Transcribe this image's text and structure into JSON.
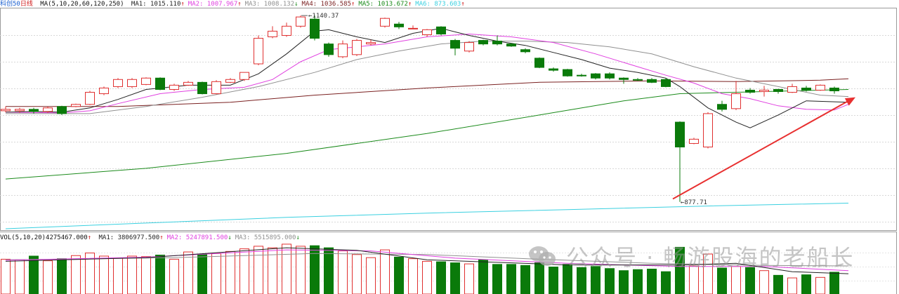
{
  "chart_data": {
    "type": "candlestick",
    "title": "科创50日线",
    "instrument": "科创50",
    "period": "日线",
    "ma_label": "MA(5,10,20,60,120,250)",
    "ma_readouts": [
      {
        "name": "MA1",
        "value": "1015.110",
        "arrow": "↑",
        "color": "#222222"
      },
      {
        "name": "MA2",
        "value": "1007.967",
        "arrow": "↑",
        "color": "#e040e0"
      },
      {
        "name": "MA3",
        "value": "1008.132",
        "arrow": "↓",
        "color": "#909090"
      },
      {
        "name": "MA4",
        "value": "1036.585",
        "arrow": "↑",
        "color": "#7a2020"
      },
      {
        "name": "MA5",
        "value": "1013.672",
        "arrow": "↑",
        "color": "#1a8a1a"
      },
      {
        "name": "MA6",
        "value": "873.603",
        "arrow": "↑",
        "color": "#3ad0e0"
      }
    ],
    "annotations": {
      "high_label": "1140.37",
      "low_label": "877.71"
    },
    "price_range": [
      840,
      1150
    ],
    "candles": [
      [
        1006,
        1008,
        1012,
        1004
      ],
      [
        1006,
        1008,
        1010,
        1003
      ],
      [
        1008,
        1005,
        1010,
        1002
      ],
      [
        1005,
        1010,
        1012,
        1003
      ],
      [
        1012,
        1002,
        1013,
        1000
      ],
      [
        1012,
        1015,
        1016,
        1011
      ],
      [
        1015,
        1032,
        1034,
        1014
      ],
      [
        1030,
        1038,
        1040,
        1028
      ],
      [
        1040,
        1050,
        1052,
        1038
      ],
      [
        1040,
        1050,
        1052,
        1038
      ],
      [
        1043,
        1052,
        1053,
        1042
      ],
      [
        1052,
        1036,
        1053,
        1035
      ],
      [
        1036,
        1042,
        1044,
        1034
      ],
      [
        1042,
        1046,
        1048,
        1041
      ],
      [
        1046,
        1030,
        1047,
        1029
      ],
      [
        1030,
        1047,
        1049,
        1029
      ],
      [
        1046,
        1050,
        1052,
        1045
      ],
      [
        1050,
        1060,
        1060,
        1048
      ],
      [
        1072,
        1108,
        1112,
        1070
      ],
      [
        1110,
        1118,
        1125,
        1108
      ],
      [
        1112,
        1125,
        1130,
        1110
      ],
      [
        1125,
        1138,
        1140,
        1123
      ],
      [
        1135,
        1108,
        1140,
        1105
      ],
      [
        1100,
        1085,
        1102,
        1082
      ],
      [
        1082,
        1100,
        1105,
        1080
      ],
      [
        1085,
        1105,
        1107,
        1083
      ],
      [
        1100,
        1102,
        1106,
        1098
      ],
      [
        1125,
        1136,
        1137,
        1123
      ],
      [
        1128,
        1124,
        1131,
        1121
      ],
      [
        1122,
        1122,
        1126,
        1121
      ],
      [
        1113,
        1120,
        1121,
        1110
      ],
      [
        1124,
        1114,
        1125,
        1112
      ],
      [
        1105,
        1094,
        1107,
        1084
      ],
      [
        1090,
        1102,
        1104,
        1088
      ],
      [
        1105,
        1100,
        1106,
        1098
      ],
      [
        1104,
        1100,
        1112,
        1098
      ],
      [
        1100,
        1097,
        1101,
        1096
      ],
      [
        1092,
        1089,
        1094,
        1087
      ],
      [
        1080,
        1067,
        1081,
        1066
      ],
      [
        1065,
        1063,
        1067,
        1061
      ],
      [
        1064,
        1055,
        1065,
        1054
      ],
      [
        1056,
        1055,
        1058,
        1054
      ],
      [
        1058,
        1052,
        1059,
        1050
      ],
      [
        1058,
        1052,
        1060,
        1050
      ],
      [
        1052,
        1050,
        1053,
        1044
      ],
      [
        1050,
        1049,
        1052,
        1048
      ],
      [
        1050,
        1046,
        1052,
        1045
      ],
      [
        1050,
        1040,
        1052,
        1039
      ],
      [
        990,
        955,
        991,
        877.71
      ],
      [
        960,
        966,
        968,
        959
      ],
      [
        955,
        1002,
        1004,
        953
      ],
      [
        1015,
        1008,
        1020,
        1005
      ],
      [
        1009,
        1030,
        1048,
        1007
      ],
      [
        1035,
        1032,
        1038,
        1030
      ],
      [
        1033,
        1035,
        1041,
        1026
      ],
      [
        1036,
        1033,
        1037,
        1030
      ],
      [
        1032,
        1040,
        1044,
        1031
      ],
      [
        1038,
        1035,
        1041,
        1033
      ],
      [
        1035,
        1042,
        1043,
        1034
      ],
      [
        1038,
        1034,
        1040,
        1030
      ]
    ],
    "ma_series": [
      {
        "name": "MA1",
        "period": 5,
        "color": "#222222",
        "points": [
          [
            0,
            1004
          ],
          [
            2,
            1005
          ],
          [
            4,
            1004
          ],
          [
            6,
            1010
          ],
          [
            8,
            1022
          ],
          [
            10,
            1036
          ],
          [
            13,
            1042
          ],
          [
            16,
            1042
          ],
          [
            18,
            1058
          ],
          [
            20,
            1086
          ],
          [
            22,
            1118
          ],
          [
            23,
            1120
          ],
          [
            25,
            1110
          ],
          [
            27,
            1102
          ],
          [
            29,
            1115
          ],
          [
            31,
            1122
          ],
          [
            33,
            1112
          ],
          [
            35,
            1104
          ],
          [
            37,
            1098
          ],
          [
            39,
            1088
          ],
          [
            41,
            1078
          ],
          [
            43,
            1066
          ],
          [
            45,
            1060
          ],
          [
            47,
            1052
          ],
          [
            48,
            1040
          ],
          [
            50,
            1010
          ],
          [
            52,
            990
          ],
          [
            53,
            982
          ],
          [
            55,
            1000
          ],
          [
            57,
            1020
          ],
          [
            60,
            1018
          ]
        ]
      },
      {
        "name": "MA2",
        "period": 10,
        "color": "#e040e0",
        "points": [
          [
            0,
            1004
          ],
          [
            4,
            1003
          ],
          [
            6,
            1006
          ],
          [
            8,
            1016
          ],
          [
            11,
            1030
          ],
          [
            14,
            1036
          ],
          [
            17,
            1039
          ],
          [
            19,
            1050
          ],
          [
            21,
            1075
          ],
          [
            23,
            1092
          ],
          [
            25,
            1096
          ],
          [
            27,
            1100
          ],
          [
            30,
            1110
          ],
          [
            33,
            1114
          ],
          [
            36,
            1110
          ],
          [
            39,
            1102
          ],
          [
            42,
            1086
          ],
          [
            45,
            1068
          ],
          [
            47,
            1056
          ],
          [
            49,
            1045
          ],
          [
            51,
            1030
          ],
          [
            53,
            1023
          ],
          [
            55,
            1013
          ],
          [
            57,
            1008
          ],
          [
            59,
            1007
          ],
          [
            60,
            1015
          ]
        ]
      },
      {
        "name": "MA3",
        "period": 20,
        "color": "#909090",
        "points": [
          [
            0,
            1002
          ],
          [
            6,
            1002
          ],
          [
            10,
            1012
          ],
          [
            14,
            1025
          ],
          [
            18,
            1040
          ],
          [
            22,
            1060
          ],
          [
            25,
            1078
          ],
          [
            28,
            1090
          ],
          [
            31,
            1100
          ],
          [
            34,
            1104
          ],
          [
            37,
            1104
          ],
          [
            40,
            1102
          ],
          [
            43,
            1096
          ],
          [
            46,
            1086
          ],
          [
            49,
            1068
          ],
          [
            52,
            1052
          ],
          [
            55,
            1040
          ],
          [
            58,
            1028
          ],
          [
            60,
            1026
          ]
        ]
      },
      {
        "name": "MA4",
        "period": 60,
        "color": "#7a2020",
        "points": [
          [
            0,
            1012
          ],
          [
            8,
            1012
          ],
          [
            16,
            1018
          ],
          [
            22,
            1028
          ],
          [
            30,
            1038
          ],
          [
            38,
            1046
          ],
          [
            46,
            1048
          ],
          [
            52,
            1047
          ],
          [
            58,
            1049
          ],
          [
            60,
            1051
          ]
        ]
      },
      {
        "name": "MA5",
        "period": 120,
        "color": "#1a8a1a",
        "points": [
          [
            0,
            910
          ],
          [
            10,
            925
          ],
          [
            20,
            946
          ],
          [
            30,
            974
          ],
          [
            38,
            1000
          ],
          [
            44,
            1020
          ],
          [
            48,
            1030
          ],
          [
            52,
            1032
          ],
          [
            56,
            1034
          ],
          [
            60,
            1036
          ]
        ]
      },
      {
        "name": "MA6",
        "period": 250,
        "color": "#3ad0e0",
        "points": [
          [
            0,
            840
          ],
          [
            10,
            848
          ],
          [
            20,
            856
          ],
          [
            30,
            862
          ],
          [
            40,
            867
          ],
          [
            50,
            872
          ],
          [
            60,
            876
          ]
        ]
      }
    ],
    "trend_arrow": {
      "from": [
        47.5,
        882
      ],
      "to": [
        60.5,
        1025
      ],
      "color": "#e83030"
    },
    "volume": {
      "label": "VOL(5,10,20)",
      "value": "4275467.000",
      "value_arrow": "↑",
      "ma_readouts": [
        {
          "name": "MA1",
          "value": "3806977.500",
          "arrow": "↑",
          "color": "#222222"
        },
        {
          "name": "MA2",
          "value": "5247891.500",
          "arrow": "↓",
          "color": "#e040e0"
        },
        {
          "name": "MA3",
          "value": "5515895.000",
          "arrow": "↓",
          "color": "#909090"
        }
      ],
      "max": 10000000,
      "bars": [
        6700000,
        6600000,
        7300000,
        6400000,
        6800000,
        7400000,
        7900000,
        7300000,
        6900000,
        7300000,
        7200000,
        7500000,
        6700000,
        8100000,
        7700000,
        7800000,
        8200000,
        8700000,
        9200000,
        8900000,
        9600000,
        9200000,
        9300000,
        8900000,
        8300000,
        7600000,
        7000000,
        8500000,
        7100000,
        6800000,
        6300000,
        6200000,
        6000000,
        5800000,
        6600000,
        5700000,
        5700000,
        5500000,
        6000000,
        5200000,
        5700000,
        5100000,
        5300000,
        4900000,
        4500000,
        4700000,
        4800000,
        4300000,
        9000000,
        5400000,
        7700000,
        5000000,
        5300000,
        5100000,
        4500000,
        3600000,
        3100000,
        3700000,
        3200000,
        4200000
      ],
      "ma_lines": [
        {
          "name": "MA1",
          "color": "#222222",
          "points": [
            [
              0,
              6300000
            ],
            [
              10,
              7000000
            ],
            [
              20,
              8900000
            ],
            [
              25,
              8400000
            ],
            [
              30,
              6600000
            ],
            [
              40,
              5600000
            ],
            [
              48,
              5600000
            ],
            [
              52,
              5900000
            ],
            [
              56,
              4300000
            ],
            [
              60,
              3900000
            ]
          ]
        },
        {
          "name": "MA2",
          "color": "#e040e0",
          "points": [
            [
              0,
              6500000
            ],
            [
              10,
              7100000
            ],
            [
              20,
              8500000
            ],
            [
              26,
              8300000
            ],
            [
              32,
              6900000
            ],
            [
              40,
              5900000
            ],
            [
              48,
              5300000
            ],
            [
              54,
              5300000
            ],
            [
              60,
              4500000
            ]
          ]
        },
        {
          "name": "MA3",
          "color": "#909090",
          "points": [
            [
              0,
              6600000
            ],
            [
              12,
              7000000
            ],
            [
              22,
              7800000
            ],
            [
              30,
              7600000
            ],
            [
              38,
              6700000
            ],
            [
              46,
              5900000
            ],
            [
              54,
              5500000
            ],
            [
              60,
              5400000
            ]
          ]
        }
      ]
    }
  },
  "watermark": {
    "text": "公众号 · 畅游股海的老船长"
  }
}
